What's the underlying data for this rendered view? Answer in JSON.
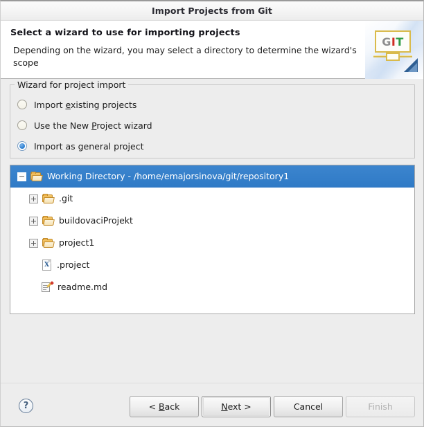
{
  "window": {
    "title": "Import Projects from Git"
  },
  "header": {
    "title": "Select a wizard to use for importing projects",
    "description": "Depending on the wizard, you may select a directory to determine the wizard's scope",
    "banner_icon": "git-banner-icon",
    "banner_letters": {
      "g": "G",
      "i": "I",
      "t": "T"
    }
  },
  "group": {
    "legend": "Wizard for project import",
    "options": [
      {
        "label_pre": "Import ",
        "label_mnemonic": "e",
        "label_post": "xisting projects",
        "selected": false
      },
      {
        "label_pre": "Use the New ",
        "label_mnemonic": "P",
        "label_post": "roject wizard",
        "selected": false
      },
      {
        "label_pre": "Import as general project",
        "label_mnemonic": "",
        "label_post": "",
        "selected": true
      }
    ]
  },
  "tree": {
    "rows": [
      {
        "label": "Working Directory - /home/emajorsinova/git/repository1",
        "icon": "folder-open-icon",
        "expander": "minus",
        "depth": 0,
        "selected": true
      },
      {
        "label": ".git",
        "icon": "folder-open-icon",
        "expander": "plus",
        "depth": 1,
        "selected": false
      },
      {
        "label": "buildovaciProjekt",
        "icon": "folder-open-icon",
        "expander": "plus",
        "depth": 1,
        "selected": false
      },
      {
        "label": "project1",
        "icon": "folder-open-icon",
        "expander": "plus",
        "depth": 1,
        "selected": false
      },
      {
        "label": ".project",
        "icon": "xml-file-icon",
        "expander": "none",
        "depth": 1,
        "selected": false
      },
      {
        "label": "readme.md",
        "icon": "markdown-file-icon",
        "expander": "none",
        "depth": 1,
        "selected": false
      }
    ]
  },
  "footer": {
    "help_label": "?",
    "buttons": [
      {
        "pre": "< ",
        "mnemonic": "B",
        "post": "ack",
        "state": "enabled",
        "name": "back-button"
      },
      {
        "pre": "",
        "mnemonic": "N",
        "post": "ext >",
        "state": "focused",
        "name": "next-button"
      },
      {
        "pre": "Cancel",
        "mnemonic": "",
        "post": "",
        "state": "enabled",
        "name": "cancel-button"
      },
      {
        "pre": "Finish",
        "mnemonic": "",
        "post": "",
        "state": "disabled",
        "name": "finish-button"
      }
    ]
  },
  "colors": {
    "selection_blue": "#2f7ac6",
    "radio_blue": "#2a7fd4",
    "body_bg": "#ededed",
    "header_bg": "#ffffff",
    "git_gray": "#8d8d8d",
    "git_red": "#cf2b22",
    "git_green": "#2f9b46"
  }
}
